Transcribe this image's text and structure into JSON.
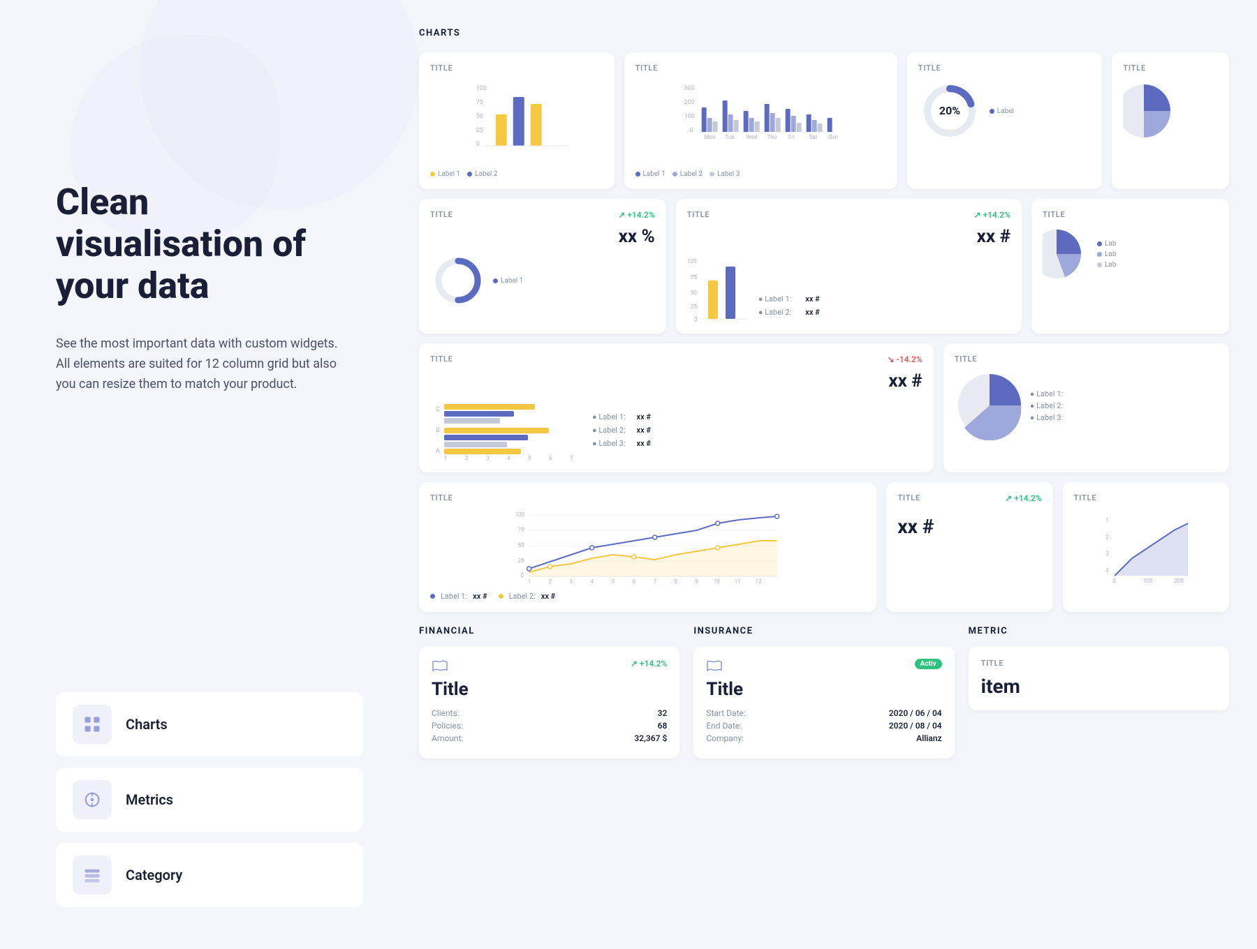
{
  "heading": "Clean visualisation of your data",
  "description": "See the most important data with custom widgets. All elements are suited for 12 column grid but also you can resize them to match your product.",
  "nav": {
    "items": [
      {
        "id": "charts",
        "label": "Charts"
      },
      {
        "id": "metrics",
        "label": "Metrics"
      },
      {
        "id": "category",
        "label": "Category"
      }
    ]
  },
  "charts_section": {
    "title": "CHARTS"
  },
  "financial_section": {
    "title": "FINANCIAL",
    "card": {
      "change": "↗ +14.2%",
      "title": "Title",
      "rows": [
        {
          "label": "Clients:",
          "value": "32"
        },
        {
          "label": "Policies:",
          "value": "68"
        },
        {
          "label": "Amount:",
          "value": "32,367 $"
        }
      ]
    }
  },
  "insurance_section": {
    "title": "INSURANCE",
    "card": {
      "badge": "Activ",
      "title": "Title",
      "rows": [
        {
          "label": "Start Date:",
          "value": "2020 / 06 / 04"
        },
        {
          "label": "End Date:",
          "value": "2020 / 08 / 04"
        },
        {
          "label": "Company:",
          "value": "Allianz"
        }
      ]
    }
  },
  "metric_section": {
    "title": "METRIC",
    "card": {
      "chart_title": "TITLE",
      "item_label": "item"
    }
  },
  "colors": {
    "purple": "#5c6bc0",
    "yellow": "#f5c842",
    "green": "#2ec27e",
    "red": "#e85555",
    "light_purple": "#9fa8da",
    "gray": "#c4c9d8",
    "blue_line": "#5c6bc0",
    "yellow_line": "#f5c842"
  },
  "chart_rows": {
    "row1": {
      "cards": [
        {
          "id": "bar-simple",
          "title": "TITLE",
          "labels": [
            "Label 1",
            "Label 2"
          ],
          "label_colors": [
            "#f5c842",
            "#5c6bc0"
          ]
        },
        {
          "id": "bar-grouped",
          "title": "TITLE",
          "y_vals": [
            300,
            200,
            100,
            0
          ],
          "x_vals": [
            "Mon",
            "Tue",
            "Wed",
            "Thu",
            "Fri",
            "Sat",
            "Sun"
          ],
          "labels": [
            "Label 1",
            "Label 2",
            "Label 3"
          ]
        },
        {
          "id": "donut-20",
          "title": "TITLE",
          "value": "20%",
          "label": "Label"
        },
        {
          "id": "pie-quarter",
          "title": "TITLE"
        }
      ]
    },
    "row2": {
      "cards": [
        {
          "id": "donut-stat",
          "title": "TITLE",
          "change": "↗ +14.2%",
          "value": "xx %",
          "label": "Label 1"
        },
        {
          "id": "bar-stat",
          "title": "TITLE",
          "change": "↗ +14.2%",
          "value": "xx #",
          "label1": "Label 1:",
          "val1": "xx #",
          "label2": "Label 2:",
          "val2": "xx #"
        },
        {
          "id": "pie-stat",
          "title": "TITLE",
          "labels": [
            "Lab",
            "Lab",
            "Lab"
          ]
        }
      ]
    },
    "row3": {
      "cards": [
        {
          "id": "bar-horizontal",
          "title": "TITLE",
          "change": "↘ -14.2%",
          "value": "xx #",
          "label1": "Label 1:",
          "val1": "xx #",
          "label2": "Label 2:",
          "val2": "xx #",
          "label3": "Label 3:",
          "val3": "xx #",
          "rows": [
            "C",
            "B",
            "A"
          ]
        },
        {
          "id": "pie-large",
          "title": "TITLE",
          "labels": [
            "Label 1:",
            "Label 2:",
            "Label 3:"
          ]
        }
      ]
    },
    "row4": {
      "cards": [
        {
          "id": "line-chart",
          "title": "TITLE",
          "x_vals": [
            1,
            2,
            3,
            4,
            5,
            6,
            7,
            8,
            9,
            10,
            11,
            12
          ],
          "y_vals": [
            0,
            25,
            50,
            75,
            100
          ],
          "label1": "Label 1:",
          "val1": "xx #",
          "label2": "Label 2:",
          "val2": "xx #"
        },
        {
          "id": "line-stat",
          "title": "TITLE",
          "change": "↗ +14.2%",
          "value": "xx #"
        },
        {
          "id": "area-chart",
          "title": "TITLE",
          "x_vals": [
            0,
            100,
            200
          ],
          "y_vals": [
            1,
            2,
            3,
            4
          ]
        }
      ]
    }
  }
}
